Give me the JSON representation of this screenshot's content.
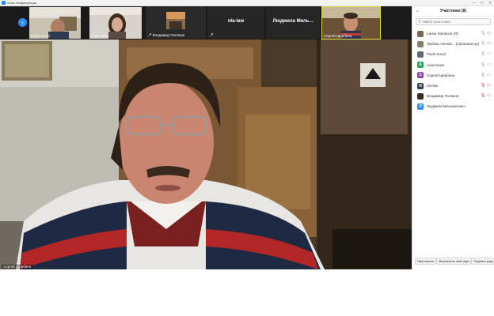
{
  "window": {
    "title": "Zoom Конференция"
  },
  "strip": {
    "tiles": [
      {
        "name": "Pavlo Koval",
        "muted": false
      },
      {
        "name": "Анастасия",
        "muted": false
      },
      {
        "name": "Владимир Поляков",
        "muted": true
      },
      {
        "label": "nla-law",
        "muted": true
      },
      {
        "label": "Людмила Мель...",
        "muted": false
      },
      {
        "name": "Сергей Щербина",
        "muted": false,
        "active": true
      }
    ]
  },
  "main_video": {
    "speaker_name": "Сергей Щербина"
  },
  "panel": {
    "title": "Участники (8)",
    "search_placeholder": "Найти участника",
    "participants": [
      {
        "name": "Larisa Starikova (Я)",
        "avatar": "",
        "avatar_color": "#7a6a55",
        "mic": "on",
        "cam": "off"
      },
      {
        "name": "Любовь Нелюб... (Организатор)",
        "avatar": "",
        "avatar_color": "#8a7d6a",
        "mic": "on",
        "cam": "off"
      },
      {
        "name": "Pavlo Koval",
        "avatar": "",
        "avatar_color": "#5f6d78",
        "mic": "on",
        "cam": "on"
      },
      {
        "name": "Анастасия",
        "avatar": "A",
        "avatar_color": "#23a55a",
        "mic": "on",
        "cam": "on"
      },
      {
        "name": "Сергей Щербина",
        "avatar": "C",
        "avatar_color": "#8e44ad",
        "mic": "on",
        "cam": "on"
      },
      {
        "name": "nla-law",
        "avatar": "N",
        "avatar_color": "#2c3e50",
        "mic": "muted",
        "cam": "off"
      },
      {
        "name": "Владимир Поляков",
        "avatar": "",
        "avatar_color": "#3b2c20",
        "mic": "muted",
        "cam": "off"
      },
      {
        "name": "Людмила Мельниченко",
        "avatar": "Л",
        "avatar_color": "#2d8cff",
        "mic": "",
        "cam": ""
      }
    ],
    "footer": {
      "invite": "Пригласить",
      "mute_all": "Выключить мой звук",
      "raise_hand": "Поднять руку"
    }
  }
}
